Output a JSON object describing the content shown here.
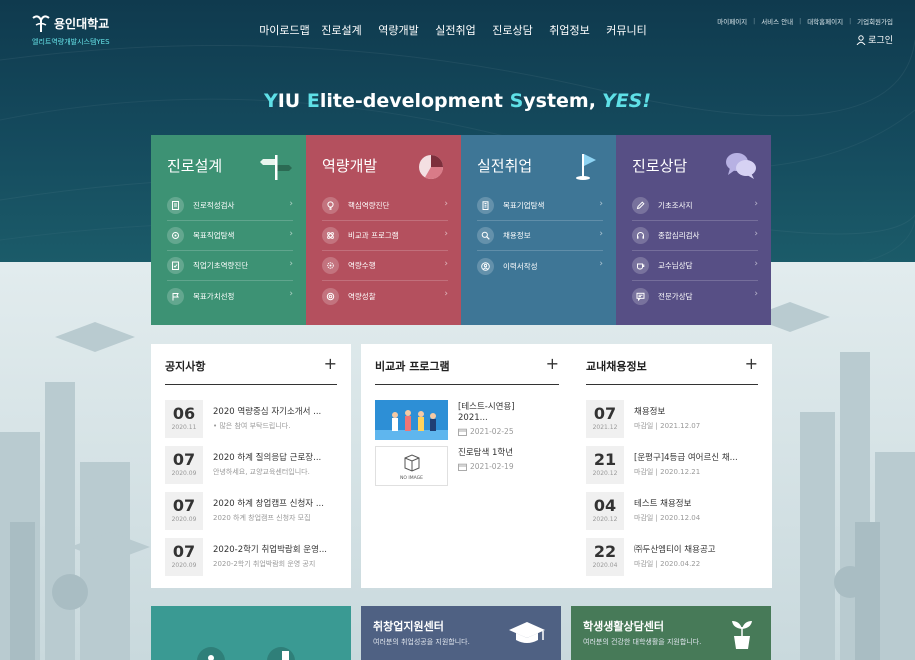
{
  "brand": {
    "name": "용인대학교",
    "sub": "엘리트역량개발시스템YES"
  },
  "gnb": [
    "마이로드맵",
    "진로설계",
    "역량개발",
    "실전취업",
    "진로상담",
    "취업정보",
    "커뮤니티"
  ],
  "util_links": [
    "마이페이지",
    "서비스 안내",
    "대학홈페이지",
    "기업회원가입"
  ],
  "login_label": "로그인",
  "slogan": {
    "p1": "Y",
    "p2": "IU ",
    "p3": "E",
    "p4": "lite-development ",
    "p5": "S",
    "p6": "ystem,",
    "p7": "YES!"
  },
  "tiles": [
    {
      "title": "진로설계",
      "icon": "signpost-icon",
      "items": [
        {
          "label": "진로적성검사",
          "icon": "document-icon"
        },
        {
          "label": "목표직업탐색",
          "icon": "target-icon"
        },
        {
          "label": "직업기초역량진단",
          "icon": "clipboard-icon"
        },
        {
          "label": "목표가치선정",
          "icon": "flag-icon"
        }
      ]
    },
    {
      "title": "역량개발",
      "icon": "pie-chart-icon",
      "items": [
        {
          "label": "핵심역량진단",
          "icon": "bulb-icon"
        },
        {
          "label": "비교과 프로그램",
          "icon": "atom-icon"
        },
        {
          "label": "역량수행",
          "icon": "gear-icon"
        },
        {
          "label": "역량성찰",
          "icon": "settings-icon"
        }
      ]
    },
    {
      "title": "실전취업",
      "icon": "flag-icon",
      "items": [
        {
          "label": "목표기업탐색",
          "icon": "building-icon"
        },
        {
          "label": "채용정보",
          "icon": "search-icon"
        },
        {
          "label": "이력서작성",
          "icon": "user-icon"
        }
      ]
    },
    {
      "title": "진로상담",
      "icon": "chat-bubbles-icon",
      "items": [
        {
          "label": "기초조사지",
          "icon": "pencil-icon"
        },
        {
          "label": "종합심리검사",
          "icon": "headset-icon"
        },
        {
          "label": "교수님상담",
          "icon": "cup-icon"
        },
        {
          "label": "전문가상담",
          "icon": "message-icon"
        }
      ]
    }
  ],
  "notice": {
    "title": "공지사항",
    "items": [
      {
        "day": "06",
        "ym": "2020.11",
        "title": "2020 역량중심 자기소개서 ...",
        "sub": "• 많은 참여 부탁드립니다."
      },
      {
        "day": "07",
        "ym": "2020.09",
        "title": "2020 하계 질의응답 근로장...",
        "sub": "안녕하세요, 교양교육센터입니다."
      },
      {
        "day": "07",
        "ym": "2020.09",
        "title": "2020 하계 창업캠프 신청자 ...",
        "sub": "2020 하계 창업캠프 신청자 모집"
      },
      {
        "day": "07",
        "ym": "2020.09",
        "title": "2020-2학기 취업박람회 운영...",
        "sub": "2020-2학기 취업박람회 운영 공지"
      }
    ]
  },
  "program": {
    "title": "비교과 프로그램",
    "items": [
      {
        "title1": "[테스트-시연용]",
        "title2": "2021...",
        "date": "2021-02-25",
        "thumb": "people-illustration"
      },
      {
        "title1": "진로탐색 1학년",
        "title2": "",
        "date": "2021-02-19",
        "thumb": "no-image",
        "thumb_text": "NO IMAGE"
      }
    ]
  },
  "recruit": {
    "title": "교내채용정보",
    "items": [
      {
        "day": "07",
        "ym": "2021.12",
        "title": "채용정보",
        "sub": "마감일  |  2021.12.07"
      },
      {
        "day": "21",
        "ym": "2020.12",
        "title": "[운평구]4등급 여어르신 채...",
        "sub": "마감일  |  2020.12.21"
      },
      {
        "day": "04",
        "ym": "2020.12",
        "title": "테스트 채용정보",
        "sub": "마감일  |  2020.12.04"
      },
      {
        "day": "22",
        "ym": "2020.04",
        "title": "㈜두산엠티이 채용공고",
        "sub": "마감일  |  2020.04.22"
      }
    ]
  },
  "banners": [
    {
      "title": "",
      "sub": ""
    },
    {
      "title": "취창업지원센터",
      "sub": "여러분의 취업성공을 지원합니다."
    },
    {
      "title": "학생생활상담센터",
      "sub": "여러분의 건강한 대학생활을 지원합니다."
    }
  ],
  "colors": {
    "hero": "#154b5e",
    "accent": "#5fe0e7",
    "career": "#3d9274",
    "dev": "#b4505e",
    "job": "#3e7696",
    "counsel": "#574f85"
  }
}
